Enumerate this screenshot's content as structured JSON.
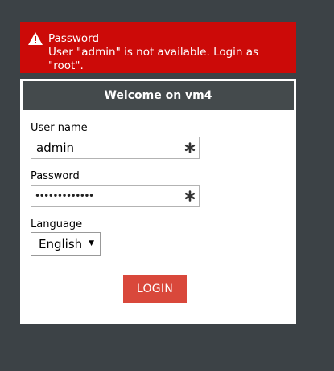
{
  "alert": {
    "link_text": "Password",
    "message": "User \"admin\" is not available. Login as \"root\".",
    "icon": "warning-icon"
  },
  "panel": {
    "title": "Welcome on vm4"
  },
  "form": {
    "username_label": "User name",
    "username_value": "admin",
    "password_label": "Password",
    "password_masked": "•••••••••••••",
    "language_label": "Language",
    "language_value": "English",
    "required_icon": "asterisk-icon",
    "submit_label": "LOGIN"
  },
  "colors": {
    "background": "#3c4246",
    "alert": "#cc0a08",
    "header": "#444a4c",
    "button": "#d9483b"
  }
}
